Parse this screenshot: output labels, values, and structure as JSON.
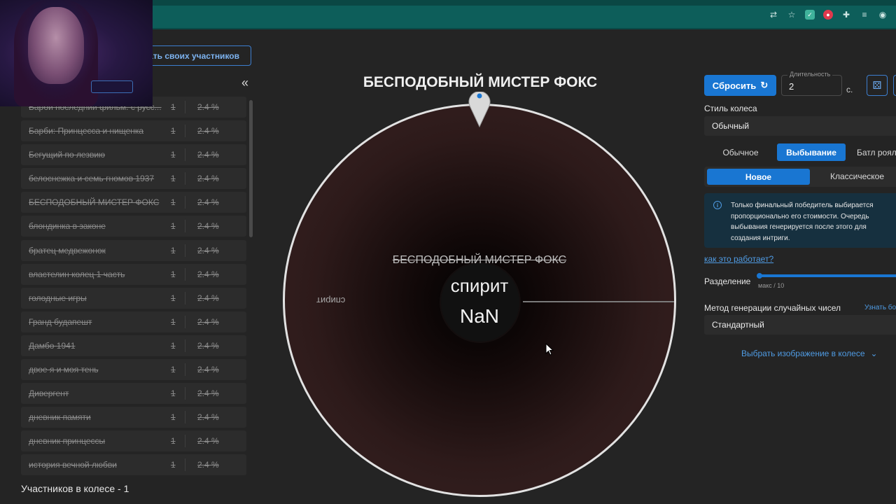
{
  "browser": {
    "icons": [
      "translate-icon",
      "star-icon",
      "extension-shield-icon",
      "extension-record-icon",
      "puzzle-icon",
      "reading-list-icon",
      "profile-avatar-icon"
    ]
  },
  "sidebar": {
    "add_button_label": "ать своих участников",
    "collapse_label": "«",
    "participants_count_label": "Участников в колесе - 1",
    "items": [
      {
        "name": "Барби последний фильм. с русс...",
        "count": "1",
        "percent": "2.4 %"
      },
      {
        "name": "Барби: Принцесса и нищенка",
        "count": "1",
        "percent": "2.4 %"
      },
      {
        "name": "Бегущий по лезвию",
        "count": "1",
        "percent": "2.4 %"
      },
      {
        "name": "белоснежка и семь гномов 1937",
        "count": "1",
        "percent": "2.4 %"
      },
      {
        "name": "БЕСПОДОБНЫЙ МИСТЕР ФОКС",
        "count": "1",
        "percent": "2.4 %"
      },
      {
        "name": "блондинка в законе",
        "count": "1",
        "percent": "2.4 %"
      },
      {
        "name": "братец медвежонок",
        "count": "1",
        "percent": "2.4 %"
      },
      {
        "name": "властелин колец 1 часть",
        "count": "1",
        "percent": "2.4 %"
      },
      {
        "name": "голодные игры",
        "count": "1",
        "percent": "2.4 %"
      },
      {
        "name": "Гранд будапешт",
        "count": "1",
        "percent": "2.4 %"
      },
      {
        "name": "Дамбо 1941",
        "count": "1",
        "percent": "2.4 %"
      },
      {
        "name": "двое я и моя тень",
        "count": "1",
        "percent": "2.4 %"
      },
      {
        "name": "Дивергент",
        "count": "1",
        "percent": "2.4 %"
      },
      {
        "name": "дневник памяти",
        "count": "1",
        "percent": "2.4 %"
      },
      {
        "name": "дневник принцессы",
        "count": "1",
        "percent": "2.4 %"
      },
      {
        "name": "история вечной любви",
        "count": "1",
        "percent": "2.4 %"
      }
    ]
  },
  "wheel": {
    "title": "БЕСПОДОБНЫЙ МИСТЕР ФОКС",
    "eliminated_label": "БЕСПОДОБНЫЙ МИСТЕР ФОКС",
    "current_name": "спирит",
    "current_value": "NaN",
    "segment_label": "спирит",
    "accent_color": "#1976d2"
  },
  "controls": {
    "reset_label": "Сбросить",
    "duration_label": "Длительность",
    "duration_value": "2",
    "duration_unit": "с.",
    "wheel_style_label": "Стиль колеса",
    "wheel_style_value": "Обычный",
    "modes": [
      "Обычное",
      "Выбывание",
      "Батл рояль"
    ],
    "active_mode": "Выбывание",
    "submodes": [
      "Новое",
      "Классическое"
    ],
    "active_submode": "Новое",
    "info_text": "Только финальный победитель выбирается пропорционально его стоимости. Очередь выбывания генерируется после этого для создания интриги.",
    "how_link": "как это работает?",
    "split_label": "Разделение",
    "split_max": "макс / 10",
    "rng_label": "Метод генерации случайных чисел",
    "rng_link": "Узнать бо",
    "rng_value": "Стандартный",
    "image_link": "Выбрать изображение в колесе"
  }
}
